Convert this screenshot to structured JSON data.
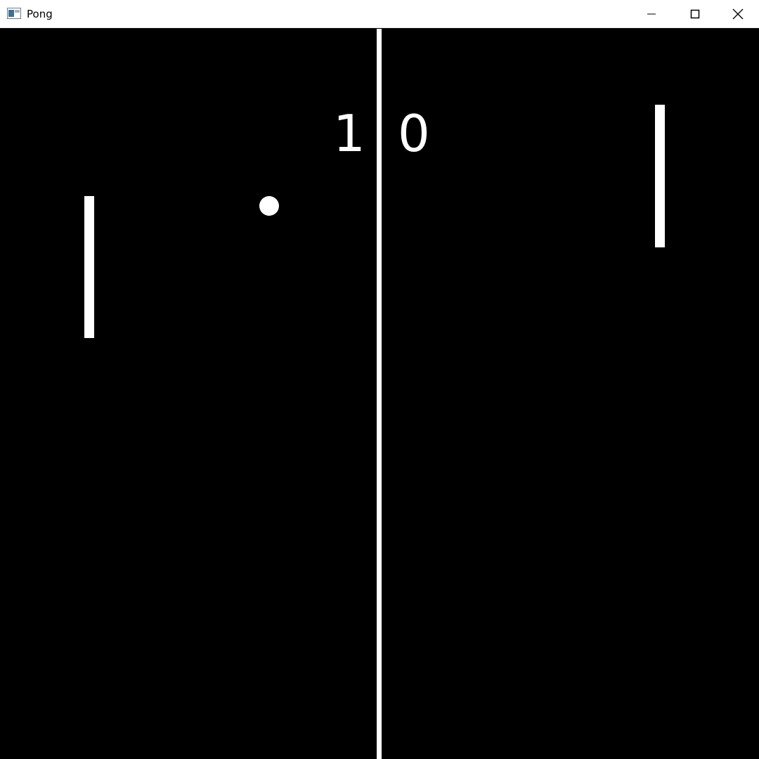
{
  "window": {
    "title": "Pong",
    "controls": {
      "minimize": "minimize-icon",
      "maximize": "maximize-icon",
      "close": "close-icon"
    }
  },
  "game": {
    "score": {
      "left": "1",
      "right": "0"
    },
    "colors": {
      "background": "#000000",
      "foreground": "#ffffff"
    }
  }
}
